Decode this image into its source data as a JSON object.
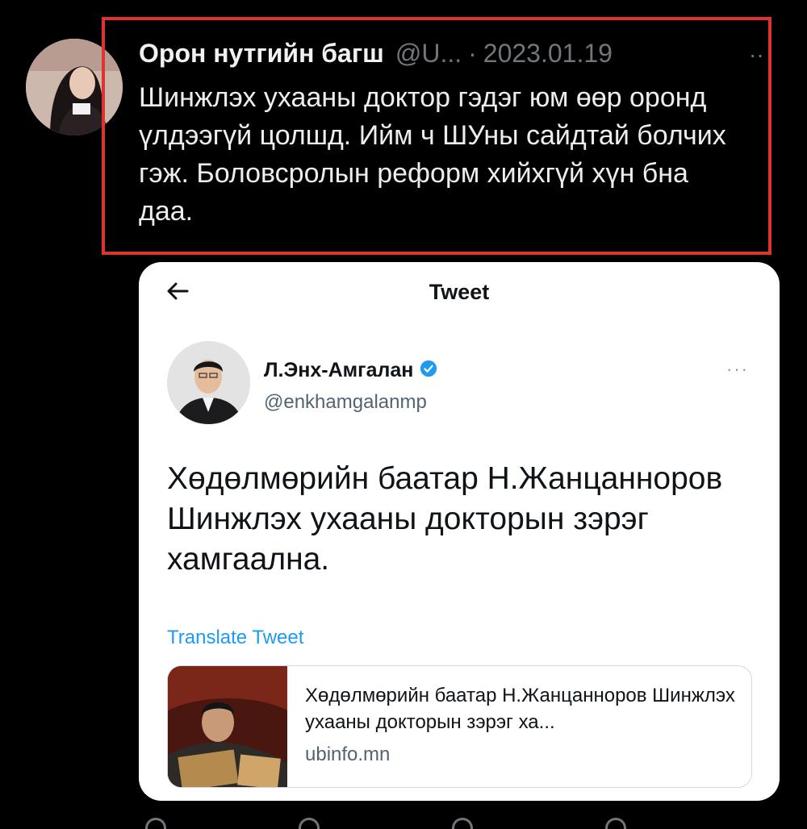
{
  "tweet": {
    "author_name": "Орон нутгийн багш",
    "handle": "@U...",
    "separator": "·",
    "date": "2023.01.19",
    "more": "··",
    "text": "Шинжлэх ухааны доктор гэдэг юм өөр оронд үлдээгүй цолшд. Ийм ч ШУны сайдтай болчих гэж. Боловсролын реформ хийхгүй хүн бна даа."
  },
  "quoted": {
    "header_title": "Tweet",
    "author_name": "Л.Энх-Амгалан",
    "handle": "@enkhamgalanmp",
    "more": "···",
    "text": "Хөдөлмөрийн баатар Н.Жанцанноров Шинжлэх ухааны докторын зэрэг хамгаална.",
    "translate": "Translate Tweet",
    "link_card": {
      "title": "Хөдөлмөрийн баатар Н.Жанцанноров Шинжлэх ухааны докторын зэрэг ха...",
      "domain": "ubinfo.mn"
    }
  },
  "colors": {
    "background": "#000000",
    "highlight": "#e0322f",
    "accent": "#1d9bf0",
    "muted": "#71767b"
  }
}
